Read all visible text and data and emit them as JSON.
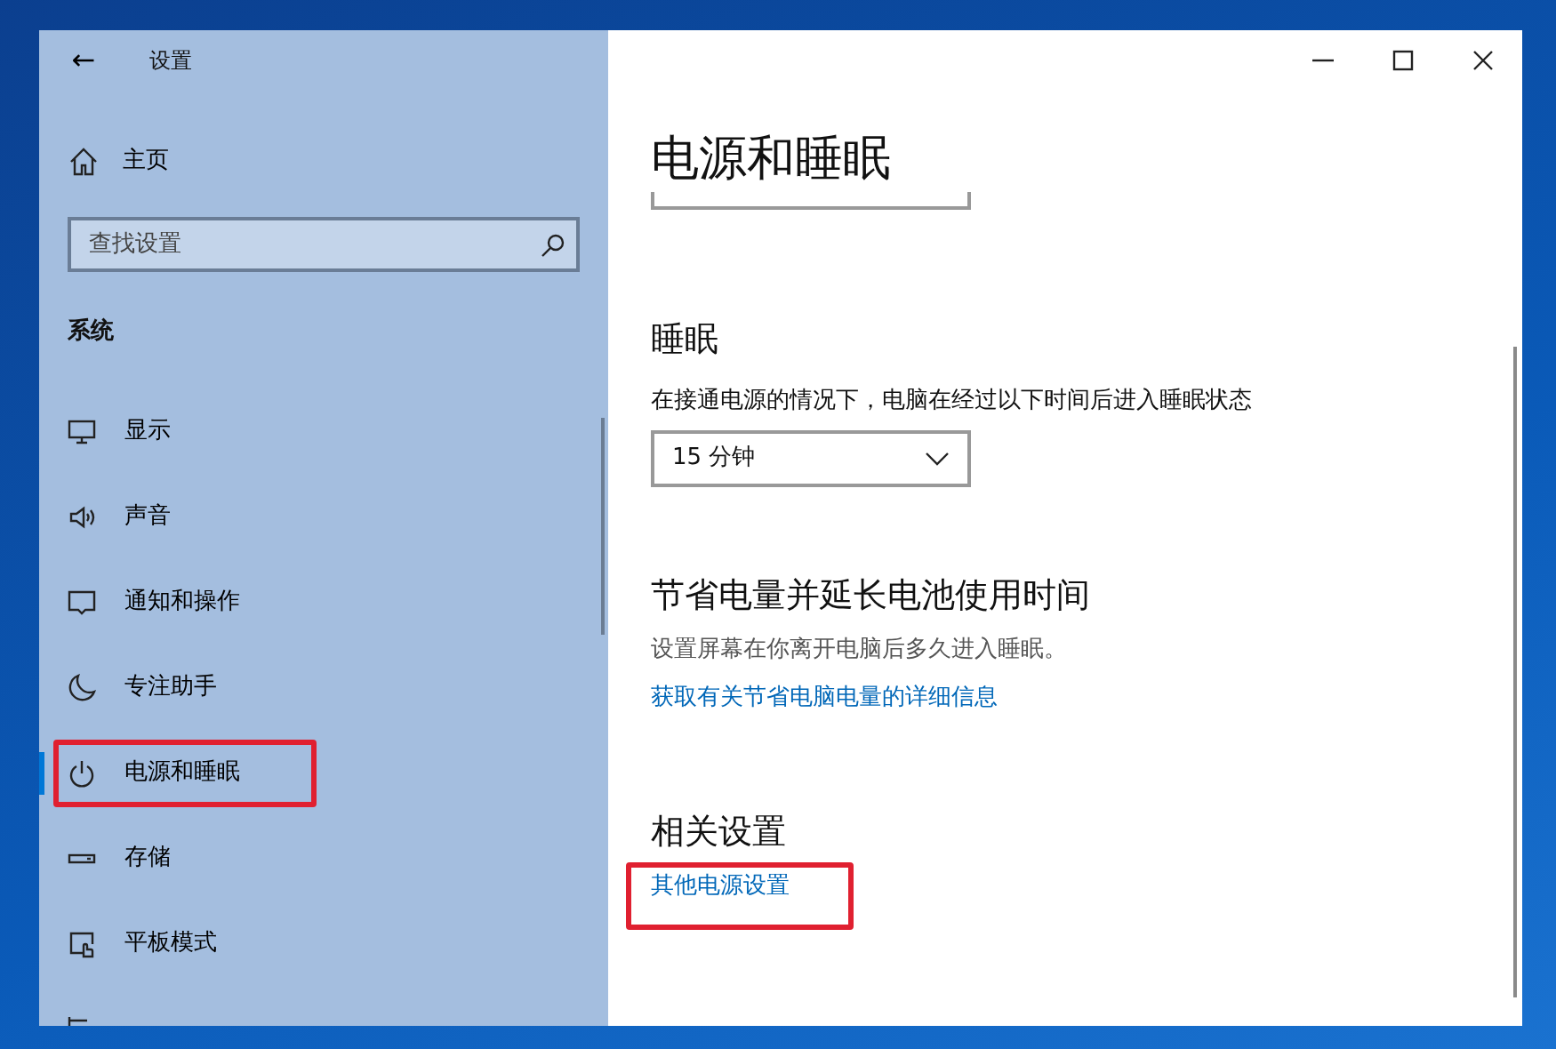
{
  "window": {
    "title": "设置",
    "back": "←"
  },
  "sidebar": {
    "home": "主页",
    "search": {
      "placeholder": "查找设置"
    },
    "section": "系统",
    "items": [
      {
        "kind": "display",
        "label": "显示",
        "selected": false,
        "highlighted": false
      },
      {
        "kind": "sound",
        "label": "声音",
        "selected": false,
        "highlighted": false
      },
      {
        "kind": "notify",
        "label": "通知和操作",
        "selected": false,
        "highlighted": false
      },
      {
        "kind": "focus",
        "label": "专注助手",
        "selected": false,
        "highlighted": false
      },
      {
        "kind": "power",
        "label": "电源和睡眠",
        "selected": true,
        "highlighted": true
      },
      {
        "kind": "storage",
        "label": "存储",
        "selected": false,
        "highlighted": false
      },
      {
        "kind": "tablet",
        "label": "平板模式",
        "selected": false,
        "highlighted": false
      },
      {
        "kind": "multitask"
      }
    ]
  },
  "page": {
    "title": "电源和睡眠",
    "sections": [
      {
        "kind": "select",
        "heading": "睡眠",
        "description": "在接通电源的情况下，电脑在经过以下时间后进入睡眠状态",
        "value": "15 分钟"
      },
      {
        "kind": "info",
        "heading": "节省电量并延长电池使用时间",
        "description": "设置屏幕在你离开电脑后多久进入睡眠。",
        "link": "获取有关节省电脑电量的详细信息",
        "highlighted": false
      },
      {
        "kind": "links",
        "heading": "相关设置",
        "link": "其他电源设置",
        "highlighted": true
      }
    ]
  }
}
